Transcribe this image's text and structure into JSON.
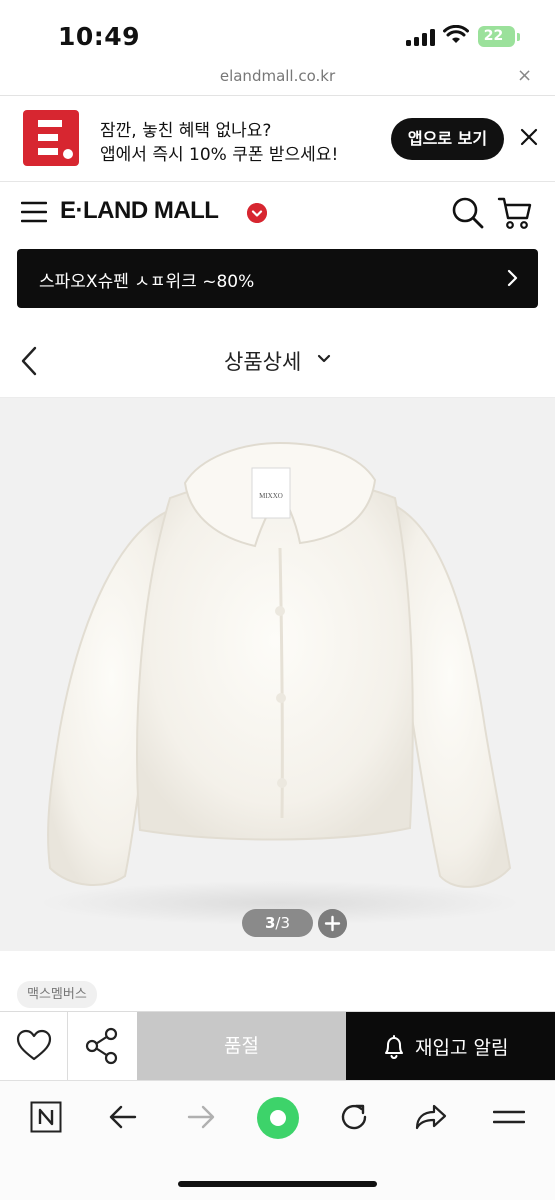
{
  "status_bar": {
    "time": "10:49",
    "battery": "22"
  },
  "url_bar": {
    "url": "elandmall.co.kr",
    "close_glyph": "×"
  },
  "app_banner": {
    "line1": "잠깐, 놓친 혜택 없나요?",
    "line2": "앱에서 즉시 10% 쿠폰 받으세요!",
    "open_app_label": "앱으로 보기",
    "logo_icon": "eland-e-logo-icon",
    "logo_color": "#d72630"
  },
  "header": {
    "brand": "E·LAND MALL",
    "badge_color": "#d72630"
  },
  "promo": {
    "text": "스파오X슈펜 ㅅㅍ위크 ~80%"
  },
  "title_row": {
    "title": "상품상세"
  },
  "product": {
    "label_text": "MIXXO",
    "counter_current": "3",
    "counter_total": "/3",
    "brand_tag": "맥스멤버스"
  },
  "purchase_bar": {
    "soldout_label": "품절",
    "restock_label": "재입고 알림"
  },
  "toolbar": {
    "icons": [
      "naver-n-icon",
      "back-arrow-icon",
      "forward-arrow-icon",
      "green-home-icon",
      "refresh-icon",
      "share-icon",
      "menu-icon"
    ],
    "accent": "#3dd36a"
  }
}
